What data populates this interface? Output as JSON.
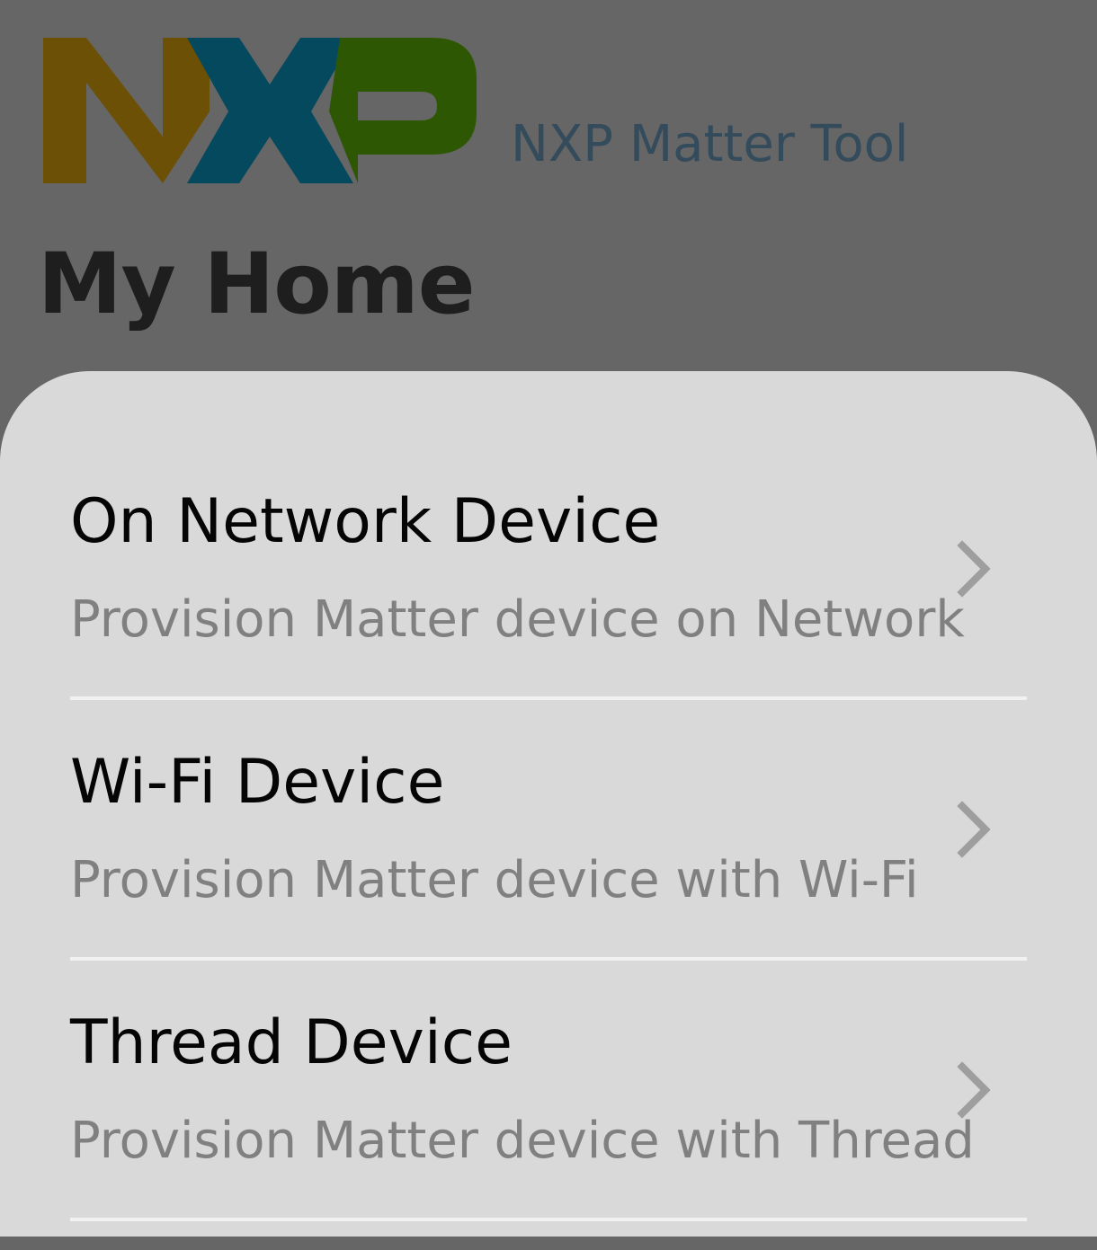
{
  "header": {
    "logo_text": "NXP",
    "app_name": "NXP Matter Tool",
    "page_title": "My Home",
    "logo_colors": {
      "n": "#6b5005",
      "x": "#05495e",
      "p": "#2e5704"
    }
  },
  "menu": {
    "items": [
      {
        "title": "On Network Device",
        "subtitle": "Provision Matter device on Network"
      },
      {
        "title": "Wi-Fi Device",
        "subtitle": "Provision Matter device with Wi-Fi"
      },
      {
        "title": "Thread Device",
        "subtitle": "Provision Matter device with Thread"
      }
    ]
  },
  "icons": {
    "chevron": "chevron-right-icon"
  },
  "colors": {
    "background_dim": "#666666",
    "sheet": "#d9d9d9",
    "app_name": "#344b5c",
    "title_text": "#050505",
    "subtitle_text": "#808080",
    "chevron": "#9e9e9e"
  }
}
